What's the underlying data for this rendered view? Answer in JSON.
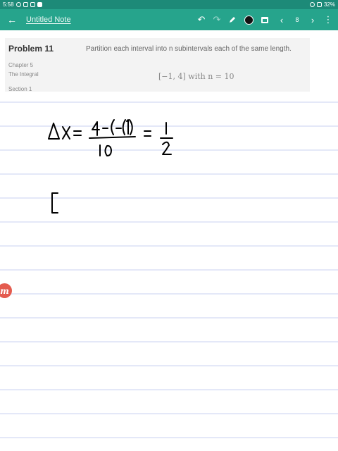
{
  "status_bar": {
    "time": "5:58",
    "battery": "32%"
  },
  "toolbar": {
    "back_icon": "arrow-left-icon",
    "title": "Untitled Note",
    "undo_icon": "undo-icon",
    "redo_icon": "redo-icon",
    "pen_icon": "pen-icon",
    "color": "#111111",
    "page_icon": "page-icon",
    "prev_icon": "chevron-left-icon",
    "page_number": "8",
    "next_icon": "chevron-right-icon",
    "more_icon": "more-vertical-icon",
    "accent": "#26a48c"
  },
  "problem": {
    "title": "Problem 11",
    "chapter": "Chapter 5",
    "topic": "The Integral",
    "section": "Section 1",
    "text": "Partition each interval into n subintervals each of the same length.",
    "math": "[−1, 4] with n = 10"
  },
  "handwriting": {
    "line1": "Δx = (4-(-1))/10 = 1/2",
    "line2": "["
  },
  "side_tab": {
    "label": "m",
    "color": "#e45b4f"
  }
}
